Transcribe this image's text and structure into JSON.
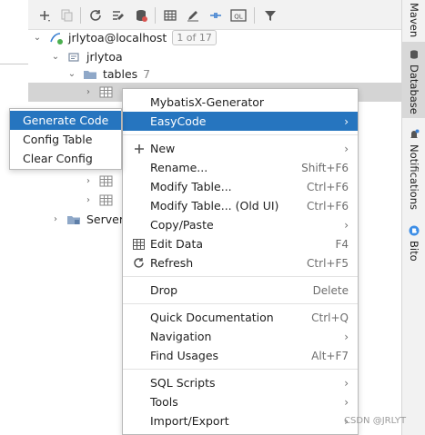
{
  "colors": {
    "accent": "#2675bf",
    "selection": "#d4d4d4",
    "folder": "#8fa8c8"
  },
  "toolbar": {
    "icons": [
      "add-icon",
      "duplicate-icon",
      "refresh-icon",
      "properties-icon",
      "datasource-icon",
      "table-icon",
      "edit-icon",
      "jump-icon",
      "ql-console-icon",
      "filter-icon"
    ],
    "ql_label": "QL"
  },
  "tree": {
    "connection": {
      "label": "jrlytoa@localhost",
      "count": "1 of 17"
    },
    "schema": {
      "label": "jrlytoa"
    },
    "tables_folder": {
      "label": "tables",
      "count": "7"
    },
    "server_objects": {
      "label": "Server"
    }
  },
  "context_menu": {
    "items": [
      {
        "label": "MybatisX-Generator"
      },
      {
        "label": "EasyCode",
        "arrow": "›"
      },
      {
        "label": "New",
        "arrow": "›",
        "icon": "plus-icon"
      },
      {
        "label": "Rename...",
        "shortcut": "Shift+F6"
      },
      {
        "label": "Modify Table...",
        "shortcut": "Ctrl+F6"
      },
      {
        "label": "Modify Table... (Old UI)",
        "shortcut": "Ctrl+F6"
      },
      {
        "label": "Copy/Paste",
        "arrow": "›"
      },
      {
        "label": "Edit Data",
        "shortcut": "F4",
        "icon": "grid-icon"
      },
      {
        "label": "Refresh",
        "shortcut": "Ctrl+F5",
        "icon": "refresh-icon"
      },
      {
        "label": "Drop",
        "shortcut": "Delete"
      },
      {
        "label": "Quick Documentation",
        "shortcut": "Ctrl+Q"
      },
      {
        "label": "Navigation",
        "arrow": "›"
      },
      {
        "label": "Find Usages",
        "shortcut": "Alt+F7"
      },
      {
        "label": "SQL Scripts",
        "arrow": "›"
      },
      {
        "label": "Tools",
        "arrow": "›"
      },
      {
        "label": "Import/Export",
        "arrow": "›"
      }
    ]
  },
  "submenu": {
    "items": [
      {
        "label": "Generate Code"
      },
      {
        "label": "Config Table"
      },
      {
        "label": "Clear Config"
      }
    ]
  },
  "right_strip": {
    "maven": "Maven",
    "database": "Database",
    "notifications": "Notifications",
    "bito": "Bito"
  },
  "watermark": "CSDN @JRLYT"
}
